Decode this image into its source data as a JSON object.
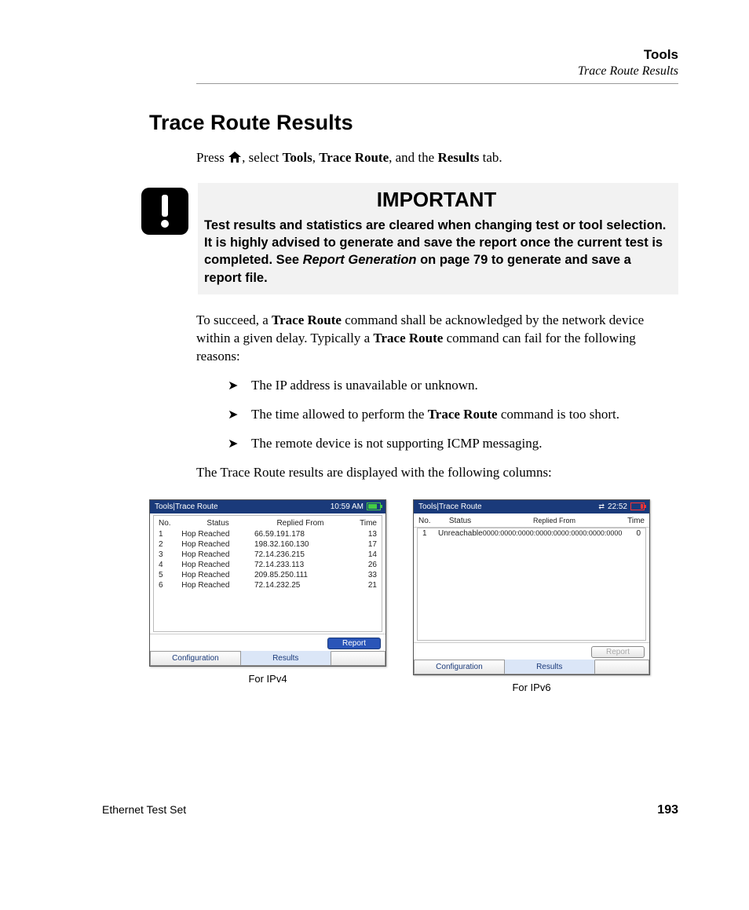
{
  "header": {
    "chapter": "Tools",
    "section": "Trace Route Results"
  },
  "title": "Trace Route Results",
  "press_line": {
    "p1": "Press ",
    "p2": ", select ",
    "b1": "Tools",
    "p3": ", ",
    "b2": "Trace Route",
    "p4": ", and the ",
    "b3": "Results",
    "p5": " tab."
  },
  "important": {
    "heading": "IMPORTANT",
    "body_pre": "Test results and statistics are cleared when changing test or tool selection. It is highly advised to generate and save the report once the current test is completed. See ",
    "body_em": "Report Generation",
    "body_post": " on page 79 to generate and save a report file."
  },
  "para2": {
    "t1": "To succeed, a ",
    "b1": "Trace Route",
    "t2": " command shall be acknowledged by the network device within a given delay. Typically a ",
    "b2": "Trace Route",
    "t3": " command can fail for the following reasons:"
  },
  "bullets": [
    {
      "t1": "The IP address is unavailable or unknown."
    },
    {
      "t1": "The time allowed to perform the ",
      "b": "Trace Route",
      "t2": " command is too short."
    },
    {
      "t1": "The remote device is not supporting ICMP messaging."
    }
  ],
  "para3": "The Trace Route results are displayed with the following columns:",
  "screenshots": {
    "common": {
      "title_path": "Tools|Trace Route",
      "cols": {
        "no": "No.",
        "status": "Status",
        "from": "Replied From",
        "time": "Time"
      },
      "report_label": "Report",
      "tabs": {
        "config": "Configuration",
        "results": "Results"
      }
    },
    "ipv4": {
      "clock": "10:59 AM",
      "caption": "For IPv4",
      "rows": [
        {
          "no": "1",
          "status": "Hop Reached",
          "from": "66.59.191.178",
          "time": "13"
        },
        {
          "no": "2",
          "status": "Hop Reached",
          "from": "198.32.160.130",
          "time": "17"
        },
        {
          "no": "3",
          "status": "Hop Reached",
          "from": "72.14.236.215",
          "time": "14"
        },
        {
          "no": "4",
          "status": "Hop Reached",
          "from": "72.14.233.113",
          "time": "26"
        },
        {
          "no": "5",
          "status": "Hop Reached",
          "from": "209.85.250.111",
          "time": "33"
        },
        {
          "no": "6",
          "status": "Hop Reached",
          "from": "72.14.232.25",
          "time": "21"
        }
      ]
    },
    "ipv6": {
      "clock": "22:52",
      "caption": "For IPv6",
      "rows": [
        {
          "no": "1",
          "status": "Unreachable",
          "from": "0000:0000:0000:0000:0000:0000:0000:0000",
          "time": "0"
        }
      ]
    }
  },
  "footer": {
    "product": "Ethernet Test Set",
    "page": "193"
  }
}
